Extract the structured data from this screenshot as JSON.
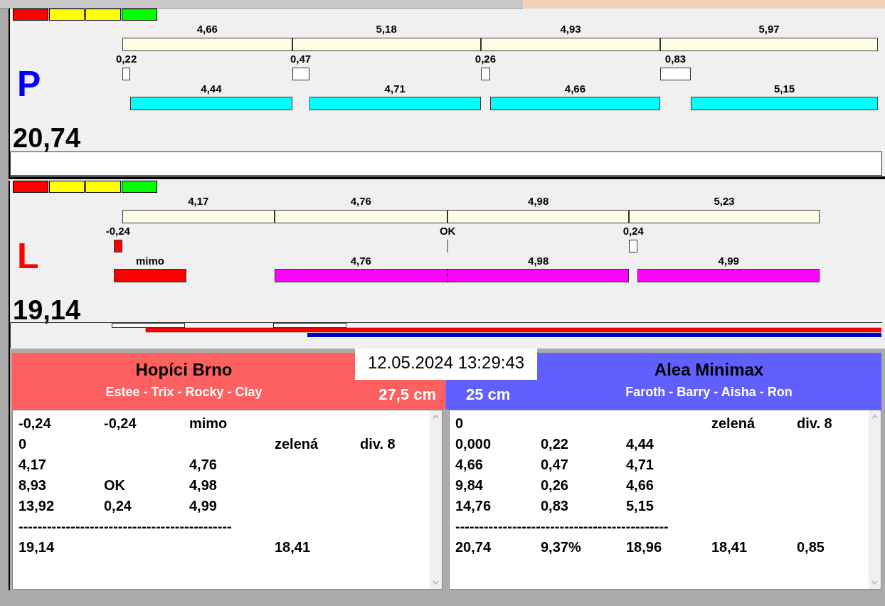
{
  "lanes": [
    {
      "letter": "P",
      "color": "#0000ff",
      "bar": {
        "color": "#00ffff"
      },
      "total": "20,74",
      "track": {
        "kind": "empty"
      },
      "lights": [
        {
          "color": "#ff0000"
        },
        {
          "color": "#ffff00"
        },
        {
          "color": "#ffff00"
        },
        {
          "color": "#00ff00"
        }
      ],
      "slots": [
        {
          "reference": "4,66",
          "reaction": {
            "kind": "box",
            "text": "0,22"
          },
          "result": {
            "kind": "bar",
            "text": "4,44"
          }
        },
        {
          "reference": "5,18",
          "reaction": {
            "kind": "box",
            "text": "0,47"
          },
          "result": {
            "kind": "bar",
            "text": "4,71"
          }
        },
        {
          "reference": "4,93",
          "reaction": {
            "kind": "box",
            "text": "0,26"
          },
          "result": {
            "kind": "bar",
            "text": "4,66"
          }
        },
        {
          "reference": "5,97",
          "reaction": {
            "kind": "box",
            "text": "0,83"
          },
          "result": {
            "kind": "bar",
            "text": "5,15"
          }
        }
      ]
    },
    {
      "letter": "L",
      "color": "#ff0000",
      "bar": {
        "color": "#ff00ff"
      },
      "total": "19,14",
      "track": {
        "kind": "progress"
      },
      "lights": [
        {
          "color": "#ff0000"
        },
        {
          "color": "#ffff00"
        },
        {
          "color": "#ffff00"
        },
        {
          "color": "#00ff00"
        }
      ],
      "slots": [
        {
          "reference": "4,17",
          "reaction": {
            "kind": "early",
            "text": "-0,24"
          },
          "result": {
            "kind": "fault",
            "text": "mimo"
          }
        },
        {
          "reference": "4,76",
          "result": {
            "kind": "bar",
            "text": "4,76"
          }
        },
        {
          "reference": "4,98",
          "reaction": {
            "kind": "line",
            "text": "OK"
          },
          "result": {
            "kind": "bar",
            "text": "4,98"
          }
        },
        {
          "reference": "5,23",
          "reaction": {
            "kind": "box",
            "text": "0,24"
          },
          "result": {
            "kind": "bar",
            "text": "4,99"
          }
        }
      ]
    }
  ],
  "datetime": "12.05.2024 13:29:43",
  "teams": [
    {
      "name": "Hopíci Brno",
      "dogs": "Estee - Trix - Rocky - Clay",
      "height": "27,5 cm",
      "color": "#ff6060",
      "rows": [
        {
          "kind": "values",
          "cells": [
            "-0,24",
            "-0,24",
            "mimo",
            "",
            ""
          ]
        },
        {
          "kind": "values",
          "cells": [
            "0",
            "",
            "",
            "zelená",
            "div. 8"
          ]
        },
        {
          "kind": "values",
          "cells": [
            "4,17",
            "",
            "4,76",
            "",
            ""
          ]
        },
        {
          "kind": "values",
          "cells": [
            "8,93",
            "OK",
            "4,98",
            "",
            ""
          ]
        },
        {
          "kind": "values",
          "cells": [
            "13,92",
            "0,24",
            "4,99",
            "",
            ""
          ]
        },
        {
          "kind": "rule",
          "text": "---------------------------------------------"
        },
        {
          "kind": "values",
          "cells": [
            "19,14",
            "",
            "",
            "18,41",
            ""
          ]
        }
      ]
    },
    {
      "name": "Alea Minimax",
      "dogs": "Faroth - Barry - Aisha - Ron",
      "height": "25 cm",
      "color": "#6060ff",
      "rows": [
        {
          "kind": "values",
          "cells": [
            "0",
            "",
            "",
            "zelená",
            "div. 8"
          ]
        },
        {
          "kind": "values",
          "cells": [
            "0,000",
            "0,22",
            "4,44",
            "",
            ""
          ]
        },
        {
          "kind": "values",
          "cells": [
            "4,66",
            "0,47",
            "4,71",
            "",
            ""
          ]
        },
        {
          "kind": "values",
          "cells": [
            "9,84",
            "0,26",
            "4,66",
            "",
            ""
          ]
        },
        {
          "kind": "values",
          "cells": [
            "14,76",
            "0,83",
            "5,15",
            "",
            ""
          ]
        },
        {
          "kind": "rule",
          "text": "---------------------------------------------"
        },
        {
          "kind": "values",
          "cells": [
            "20,74",
            "9,37%",
            "18,96",
            "18,41",
            "0,85"
          ]
        }
      ]
    }
  ]
}
